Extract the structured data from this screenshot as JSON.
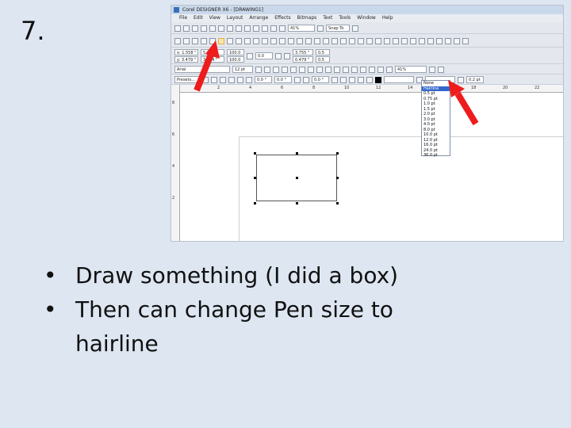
{
  "slide": {
    "number": "7.",
    "bullets": [
      "Draw something (I did a box)",
      "Then can change Pen size to hairline"
    ]
  },
  "screenshot": {
    "window_title": "Corel DESIGNER X6 - [DRAWING1]",
    "menu": [
      "File",
      "Edit",
      "View",
      "Layout",
      "Arrange",
      "Effects",
      "Bitmaps",
      "Text",
      "Tools",
      "Window",
      "Help"
    ],
    "toolbar1": {
      "zoom": "41%",
      "snap": "Snap To"
    },
    "toolbar2": {
      "x": "x: 1.558 \"",
      "y": "y: 3.479 \"",
      "w": "5.627 \"",
      "h": "3.384 \"",
      "scale_w": "100.0",
      "scale_h": "100.0",
      "angle": "0.0",
      "nudge1": "3.755 \"",
      "nudge2": "0.479 \"",
      "dup_x": "0.5",
      "dup_y": "0.5"
    },
    "toolbar3": {
      "font": "Arial",
      "font_size": "12 pt",
      "zoom2": "41%"
    },
    "toolbar4": {
      "presets": "Presets...",
      "val1": "0.0 °",
      "val2": "0.0 °",
      "val3": "0.0 °",
      "outline_value": "0.2 pt"
    },
    "ruler_top_ticks": [
      "2",
      "4",
      "6",
      "8",
      "10",
      "12",
      "14",
      "16",
      "18",
      "20",
      "22"
    ],
    "ruler_left_ticks": [
      "8",
      "6",
      "4",
      "2"
    ],
    "pen_dropdown": {
      "options": [
        "None",
        "Hairline",
        "0.5 pt",
        "0.75 pt",
        "1.0 pt",
        "1.5 pt",
        "2.0 pt",
        "3.0 pt",
        "4.0 pt",
        "8.0 pt",
        "10.0 pt",
        "12.0 pt",
        "16.0 pt",
        "24.0 pt",
        "36.0 pt"
      ],
      "selected_index": 1
    }
  },
  "colors": {
    "slide_bg": "#dde6f1",
    "arrow": "#ee1c1c",
    "dropdown_selection": "#3366cc"
  }
}
